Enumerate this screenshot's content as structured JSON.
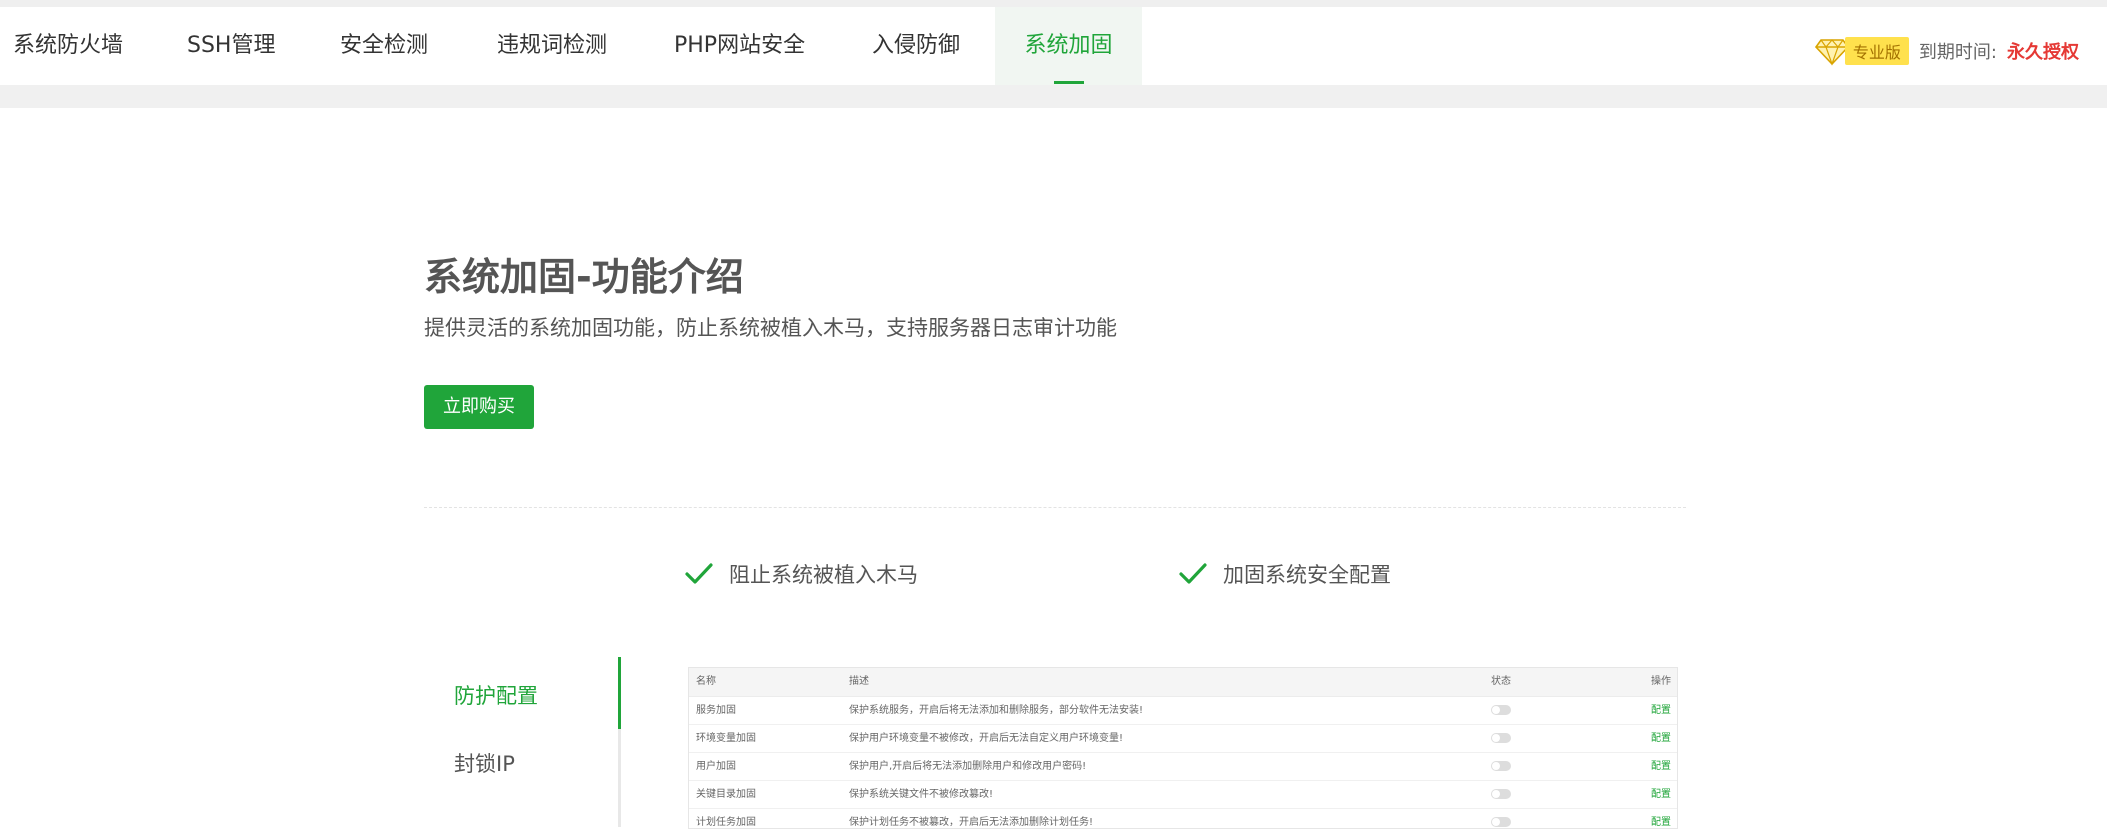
{
  "nav": {
    "tabs": [
      {
        "label": "系统防火墙"
      },
      {
        "label": "SSH管理"
      },
      {
        "label": "安全检测"
      },
      {
        "label": "违规词检测"
      },
      {
        "label": "PHP网站安全"
      },
      {
        "label": "入侵防御"
      },
      {
        "label": "系统加固",
        "active": true
      }
    ]
  },
  "license": {
    "badge": "专业版",
    "expire_label": "到期时间:",
    "expire_value": "永久授权",
    "gem_icon": "diamond-icon"
  },
  "intro": {
    "title": "系统加固-功能介绍",
    "description": "提供灵活的系统加固功能，防止系统被植入木马，支持服务器日志审计功能",
    "buy_label": "立即购买"
  },
  "features": [
    {
      "label": "阻止系统被植入木马",
      "icon": "check-icon"
    },
    {
      "label": "加固系统安全配置",
      "icon": "check-icon"
    }
  ],
  "sidemenu": {
    "items": [
      {
        "label": "防护配置",
        "active": true
      },
      {
        "label": "封锁IP"
      }
    ]
  },
  "preview": {
    "headers": [
      "名称",
      "描述",
      "状态",
      "操作"
    ],
    "rows": [
      {
        "name": "服务加固",
        "desc": "保护系统服务，开启后将无法添加和删除服务，部分软件无法安装!",
        "action": "配置"
      },
      {
        "name": "环境变量加固",
        "desc": "保护用户环境变量不被修改，开启后无法自定义用户环境变量!",
        "action": "配置"
      },
      {
        "name": "用户加固",
        "desc": "保护用户,开启后将无法添加删除用户和修改用户密码!",
        "action": "配置"
      },
      {
        "name": "关键目录加固",
        "desc": "保护系统关键文件不被修改篡改!",
        "action": "配置"
      },
      {
        "name": "计划任务加固",
        "desc": "保护计划任务不被篡改，开启后无法添加删除计划任务!",
        "action": "配置"
      }
    ]
  },
  "colors": {
    "accent": "#20a53a",
    "expire": "#e53935",
    "badge_bg": "#ffe14d"
  }
}
